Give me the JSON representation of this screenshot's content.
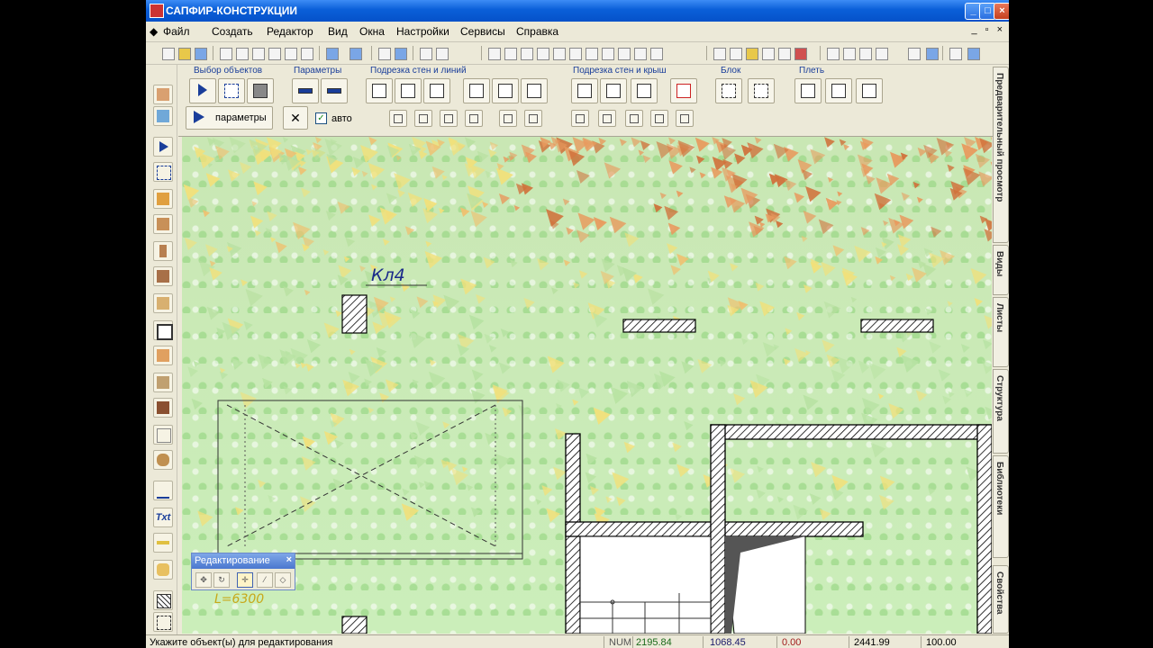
{
  "window": {
    "title": "САПФИР-КОНСТРУКЦИИ"
  },
  "menu": [
    "Файл",
    "Создать",
    "Редактор",
    "Вид",
    "Окна",
    "Настройки",
    "Сервисы",
    "Справка"
  ],
  "ribbon": {
    "groups": [
      "Выбор объектов",
      "Параметры",
      "Подрезка стен и линий",
      "Подрезка стен и крыш",
      "Блок",
      "Плеть"
    ],
    "params_button": "параметры",
    "auto_checkbox": {
      "label": "авто",
      "checked": true
    }
  },
  "right_tabs": [
    "Предварительный просмотр",
    "Виды",
    "Листы",
    "Структура",
    "Библиотеки",
    "Свойства"
  ],
  "left_toolbar": {
    "text_tool": "Txt"
  },
  "canvas": {
    "column_label": "Кл4",
    "dimension_label": "L=6300",
    "colors": {
      "background": "#c9e7b4",
      "leaves_orange": "#e89a5e",
      "leaves_yellow": "#f2e07a",
      "hatch": "#000000"
    }
  },
  "edit_toolbar": {
    "title": "Редактирование",
    "close": "×"
  },
  "status": {
    "hint": "Укажите объект(ы) для редактирования",
    "num": "NUM",
    "x": "2195.84",
    "y": "1068.45",
    "z": "0.00",
    "v1": "2441.99",
    "v2": "100.00"
  }
}
